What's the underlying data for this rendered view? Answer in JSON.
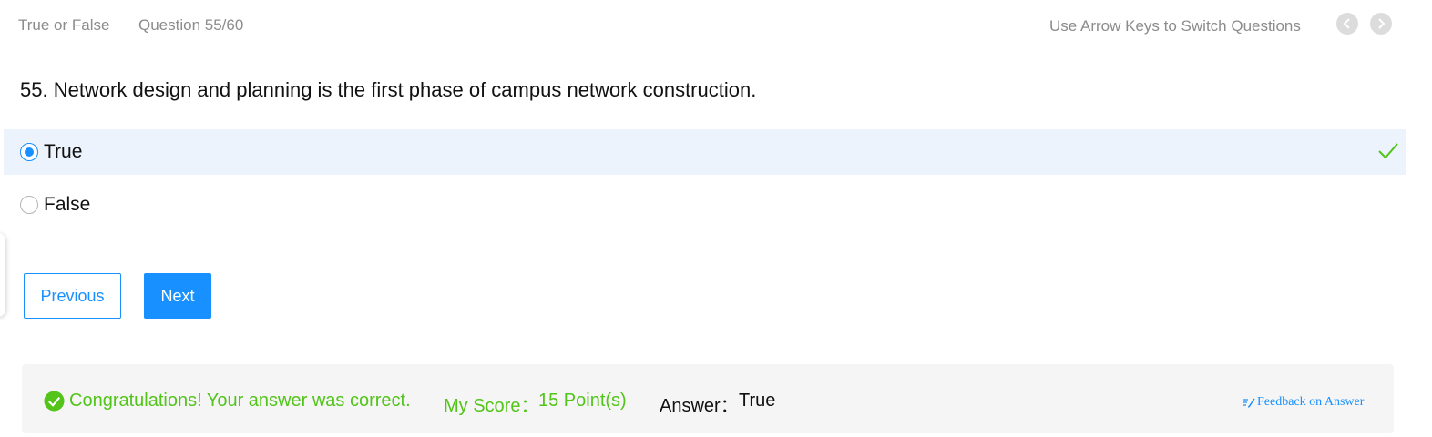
{
  "header": {
    "question_type": "True or False",
    "question_counter": "Question 55/60",
    "hint": "Use Arrow Keys to Switch Questions",
    "prev_icon": "chevron-left-icon",
    "next_icon": "chevron-right-icon"
  },
  "question": {
    "text": "55. Network design and planning is the first phase of campus network construction."
  },
  "options": [
    {
      "label": "True",
      "selected": true,
      "marked_correct": true
    },
    {
      "label": "False",
      "selected": false,
      "marked_correct": false
    }
  ],
  "buttons": {
    "previous": "Previous",
    "next": "Next"
  },
  "result": {
    "message": "Congratulations! Your answer was correct.",
    "score_label": "My Score：",
    "score_value": "15 Point(s)",
    "answer_label": "Answer：",
    "answer_value": "True",
    "feedback_link": "Feedback on Answer"
  },
  "colors": {
    "accent": "#1890ff",
    "success": "#52c41a",
    "selected_bg": "#ecf3fd",
    "muted_text": "#8c8c8c",
    "result_bg": "#f5f5f5"
  }
}
